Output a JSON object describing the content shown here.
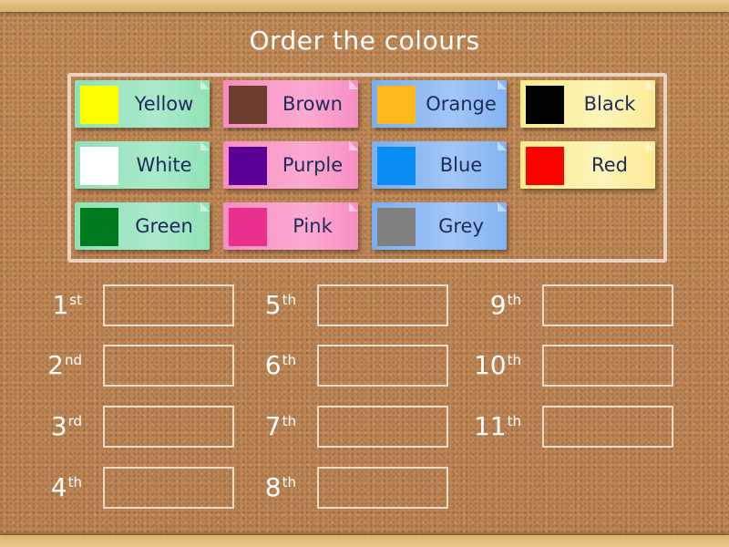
{
  "title": "Order the colours",
  "cards": [
    {
      "label": "Yellow",
      "swatch": "#ffff00",
      "theme": "green"
    },
    {
      "label": "Brown",
      "swatch": "#6b3e2e",
      "theme": "pink"
    },
    {
      "label": "Orange",
      "swatch": "#ffb81c",
      "theme": "blue"
    },
    {
      "label": "Black",
      "swatch": "#000000",
      "theme": "yellow"
    },
    {
      "label": "White",
      "swatch": "#ffffff",
      "theme": "green"
    },
    {
      "label": "Purple",
      "swatch": "#5a0096",
      "theme": "pink"
    },
    {
      "label": "Blue",
      "swatch": "#0a8cf5",
      "theme": "blue"
    },
    {
      "label": "Red",
      "swatch": "#ff0000",
      "theme": "yellow"
    },
    {
      "label": "Green",
      "swatch": "#007a1e",
      "theme": "green"
    },
    {
      "label": "Pink",
      "swatch": "#e8308c",
      "theme": "pink"
    },
    {
      "label": "Grey",
      "swatch": "#808080",
      "theme": "blue"
    }
  ],
  "slots": [
    {
      "num": "1",
      "suffix": "st",
      "value": ""
    },
    {
      "num": "2",
      "suffix": "nd",
      "value": ""
    },
    {
      "num": "3",
      "suffix": "rd",
      "value": ""
    },
    {
      "num": "4",
      "suffix": "th",
      "value": ""
    },
    {
      "num": "5",
      "suffix": "th",
      "value": ""
    },
    {
      "num": "6",
      "suffix": "th",
      "value": ""
    },
    {
      "num": "7",
      "suffix": "th",
      "value": ""
    },
    {
      "num": "8",
      "suffix": "th",
      "value": ""
    },
    {
      "num": "9",
      "suffix": "th",
      "value": ""
    },
    {
      "num": "10",
      "suffix": "th",
      "value": ""
    },
    {
      "num": "11",
      "suffix": "th",
      "value": ""
    }
  ]
}
